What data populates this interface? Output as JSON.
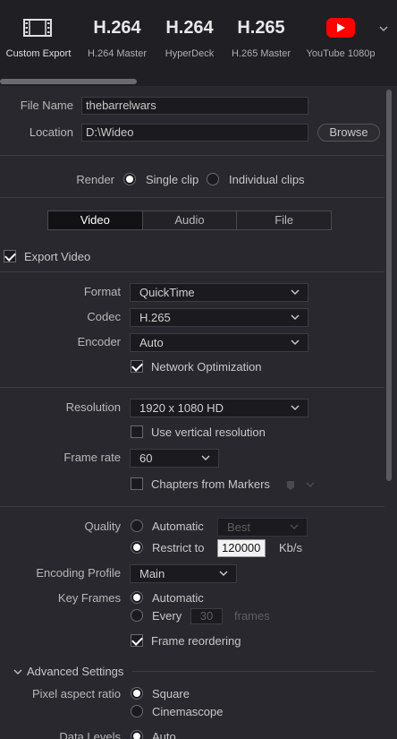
{
  "presets": [
    {
      "big": "",
      "label": "Custom Export",
      "icon": "film-icon"
    },
    {
      "big": "H.264",
      "label": "H.264 Master"
    },
    {
      "big": "H.264",
      "label": "HyperDeck"
    },
    {
      "big": "H.265",
      "label": "H.265 Master"
    },
    {
      "big": "",
      "label": "YouTube 1080p",
      "icon": "youtube-icon"
    }
  ],
  "file": {
    "name_label": "File Name",
    "name_value": "thebarrelwars",
    "location_label": "Location",
    "location_value": "D:\\Wideo",
    "browse_label": "Browse"
  },
  "render": {
    "label": "Render",
    "single_clip": "Single clip",
    "individual_clips": "Individual clips"
  },
  "tabs": [
    "Video",
    "Audio",
    "File"
  ],
  "export_video": "Export Video",
  "video": {
    "format_label": "Format",
    "format_value": "QuickTime",
    "codec_label": "Codec",
    "codec_value": "H.265",
    "encoder_label": "Encoder",
    "encoder_value": "Auto",
    "network_opt": "Network Optimization",
    "resolution_label": "Resolution",
    "resolution_value": "1920 x 1080 HD",
    "vertical_res": "Use vertical resolution",
    "framerate_label": "Frame rate",
    "framerate_value": "60",
    "chapters": "Chapters from Markers",
    "quality_label": "Quality",
    "quality_auto": "Automatic",
    "quality_best": "Best",
    "restrict_to": "Restrict to",
    "restrict_value": "120000",
    "restrict_unit": "Kb/s",
    "profile_label": "Encoding Profile",
    "profile_value": "Main",
    "keyframes_label": "Key Frames",
    "keyframes_auto": "Automatic",
    "keyframes_every": "Every",
    "keyframes_value": "30",
    "keyframes_unit": "frames",
    "frame_reorder": "Frame reordering",
    "advanced": "Advanced Settings",
    "pixel_aspect_label": "Pixel aspect ratio",
    "pixel_square": "Square",
    "pixel_cinemascope": "Cinemascope",
    "data_levels_label": "Data Levels",
    "data_levels_auto": "Auto"
  }
}
